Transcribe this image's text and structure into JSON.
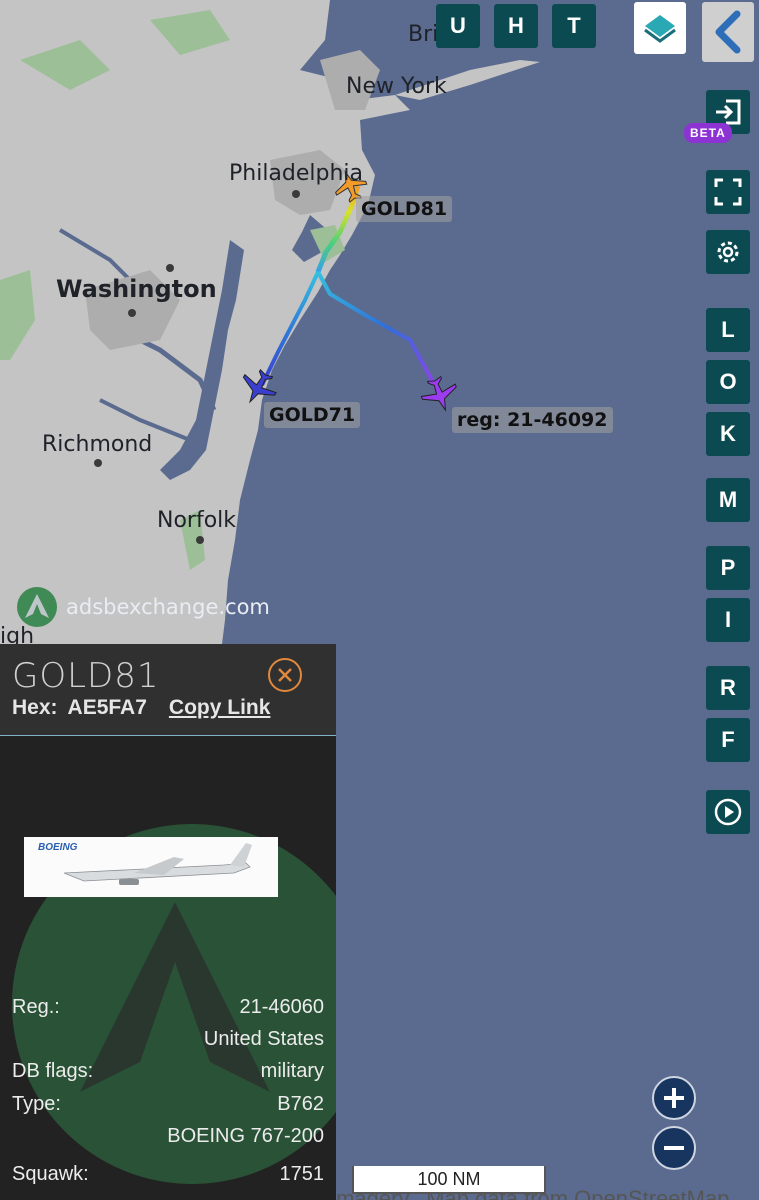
{
  "map": {
    "cities": [
      "Bri",
      "New York",
      "Philadelphia",
      "Washington",
      "Richmond",
      "Norfolk",
      "igh"
    ],
    "colors": {
      "ocean": "#5b6b8f",
      "land": "#c4c4c4",
      "urban": "#adadad",
      "forest": "#9cbf97"
    }
  },
  "aircraft": [
    {
      "callsign": "GOLD81",
      "color": "#f29a2a"
    },
    {
      "callsign": "GOLD71",
      "color": "#3b3fd0"
    },
    {
      "callsign": "reg: 21-46092",
      "color": "#9b3cf0"
    }
  ],
  "toolbar": {
    "u": "U",
    "h": "H",
    "t": "T"
  },
  "sidebar": {
    "beta": "BETA",
    "letters": [
      "L",
      "O",
      "K",
      "M",
      "P",
      "I",
      "R",
      "F"
    ]
  },
  "branding": {
    "watermark": "adsbexchange.com"
  },
  "scale": {
    "label": "100 NM"
  },
  "attribution": "Imagery...Map data from OpenStreetMap",
  "panel": {
    "title": "GOLD81",
    "hex_label": "Hex:",
    "hex_value": "AE5FA7",
    "copy_link": "Copy Link",
    "photo_brand": "BOEING",
    "rows": [
      {
        "label": "Reg.:",
        "value": "21-46060"
      },
      {
        "label": "",
        "value": "United States"
      },
      {
        "label": "DB flags:",
        "value": "military"
      },
      {
        "label": "Type:",
        "value": "B762"
      },
      {
        "label": "",
        "value": "BOEING 767-200"
      },
      {
        "label": "Squawk:",
        "value": "1751"
      }
    ]
  }
}
